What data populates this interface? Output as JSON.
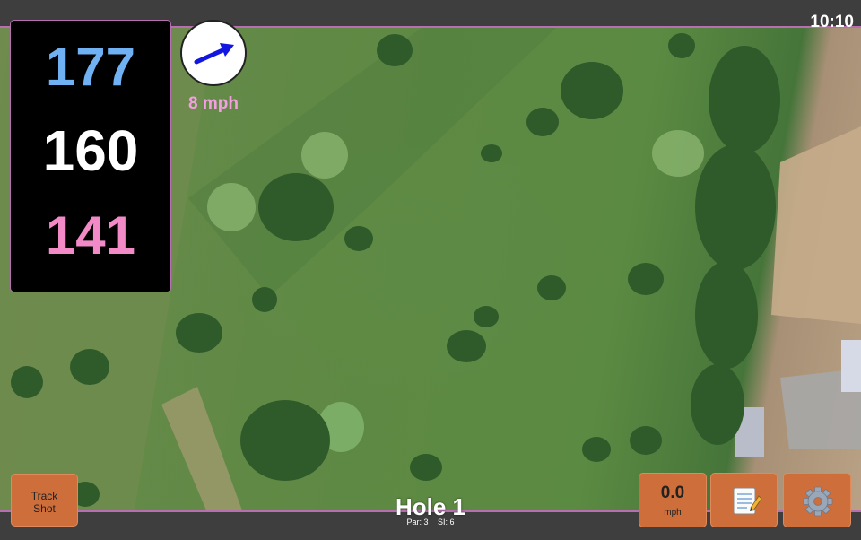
{
  "status_bar": {
    "time": "10:10"
  },
  "distances": {
    "back": "177",
    "center": "160",
    "front": "141"
  },
  "wind": {
    "speed": "8 mph",
    "icon": "wind-direction-arrow-icon"
  },
  "hole": {
    "title": "Hole 1",
    "par": "Par: 3",
    "stroke_index": "SI: 6"
  },
  "buttons": {
    "track_shot": {
      "line1": "Track",
      "line2": "Shot"
    },
    "speed": {
      "value": "0.0",
      "unit": "mph"
    },
    "notes_icon": "notepad-icon",
    "settings_icon": "gear-icon"
  },
  "colors": {
    "accent_border": "#b86fb1",
    "back_distance": "#6fb1f2",
    "center_distance": "#ffffff",
    "front_distance": "#f28ac7",
    "button_bg": "#cd6e3b",
    "wind_text": "#f2a0e0"
  }
}
